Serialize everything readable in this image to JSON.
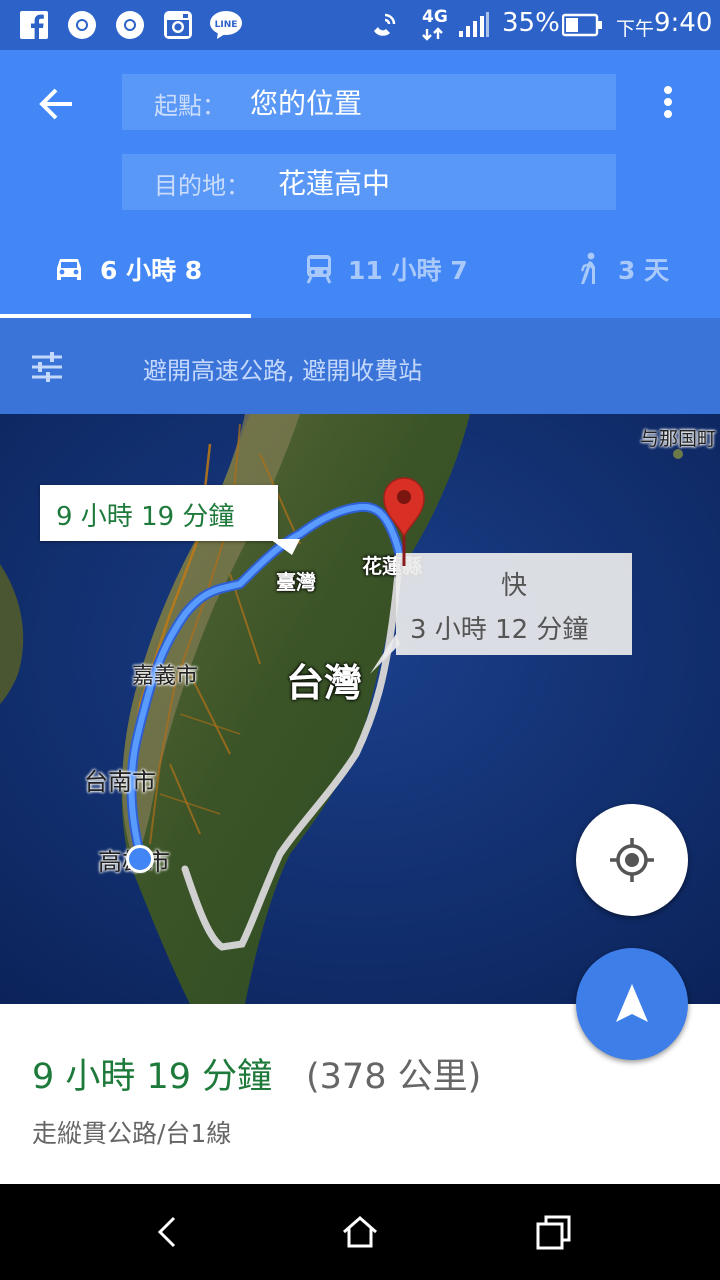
{
  "status_bar": {
    "icons": [
      "facebook-icon",
      "chrome-icon",
      "chrome-icon",
      "instagram-icon",
      "line-icon",
      "wifi-call-icon",
      "4g-icon",
      "signal-icon",
      "battery-icon"
    ],
    "network": "4G",
    "battery": "35%",
    "time_prefix": "下午",
    "time": "9:40"
  },
  "header": {
    "origin_label": "起點：",
    "origin_value": "您的位置",
    "destination_label": "目的地：",
    "destination_value": "花蓮高中",
    "tabs": [
      {
        "icon": "car-icon",
        "label": "6 小時 8",
        "active": true
      },
      {
        "icon": "train-icon",
        "label": "11 小時 7",
        "active": false
      },
      {
        "icon": "walk-icon",
        "label": "3 天",
        "active": false
      }
    ]
  },
  "options": {
    "icon": "tune-icon",
    "text": "避開高速公路, 避開收費站"
  },
  "map": {
    "labels": {
      "yonaguni": "与那国町",
      "taiwan_small": "臺灣",
      "hualien": "花蓮縣",
      "chiayi": "嘉義市",
      "taiwan_big": "台灣",
      "tainan": "台南市",
      "kaohsiung": "高雄市"
    },
    "main_route_label": "9 小時 19 分鐘",
    "alt_route_tag": "快",
    "alt_route_label": "3 小時 12 分鐘",
    "colors": {
      "route": "#4a8cff",
      "alt_route": "#c8c8c8",
      "pin": "#d93025"
    }
  },
  "sheet": {
    "duration": "9 小時 19 分鐘",
    "distance": "(378 公里)",
    "via": "走縱貫公路/台1線"
  },
  "navbar": {
    "buttons": [
      "back-icon",
      "home-icon",
      "recents-icon"
    ]
  }
}
